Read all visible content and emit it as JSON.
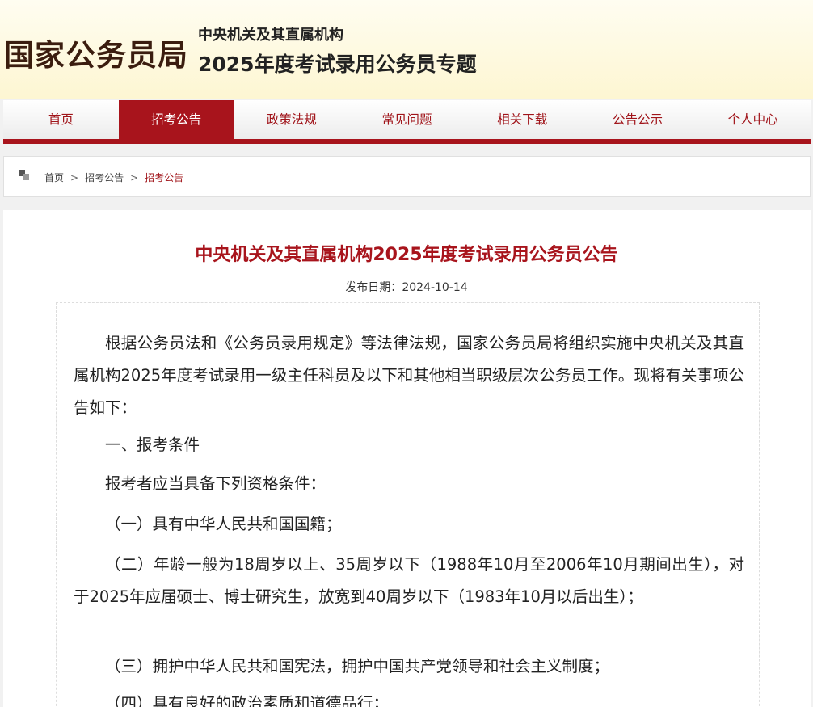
{
  "header": {
    "logo": "国家公务员局",
    "topic_sub": "中央机关及其直属机构",
    "topic_main": "2025年度考试录用公务员专题"
  },
  "nav": {
    "items": [
      "首页",
      "招考公告",
      "政策法规",
      "常见问题",
      "相关下载",
      "公告公示",
      "个人中心"
    ],
    "active": "招考公告"
  },
  "breadcrumb": {
    "items": [
      "首页",
      "招考公告",
      "招考公告"
    ],
    "separator": ">"
  },
  "article": {
    "title": "中央机关及其直属机构2025年度考试录用公务员公告",
    "date_label": "发布日期：",
    "date": "2024-10-14",
    "paragraphs": [
      "根据公务员法和《公务员录用规定》等法律法规，国家公务员局将组织实施中央机关及其直属机构2025年度考试录用一级主任科员及以下和其他相当职级层次公务员工作。现将有关事项公告如下：",
      "一、报考条件",
      "报考者应当具备下列资格条件：",
      "（一）具有中华人民共和国国籍；",
      "（二）年龄一般为18周岁以上、35周岁以下（1988年10月至2006年10月期间出生），对于2025年应届硕士、博士研究生，放宽到40周岁以下（1983年10月以后出生）；",
      "（三）拥护中华人民共和国宪法，拥护中国共产党领导和社会主义制度；",
      "（四）具有良好的政治素质和道德品行；"
    ]
  },
  "colors": {
    "brand_red": "#a8141c",
    "header_bg": "#fdf6d2"
  }
}
